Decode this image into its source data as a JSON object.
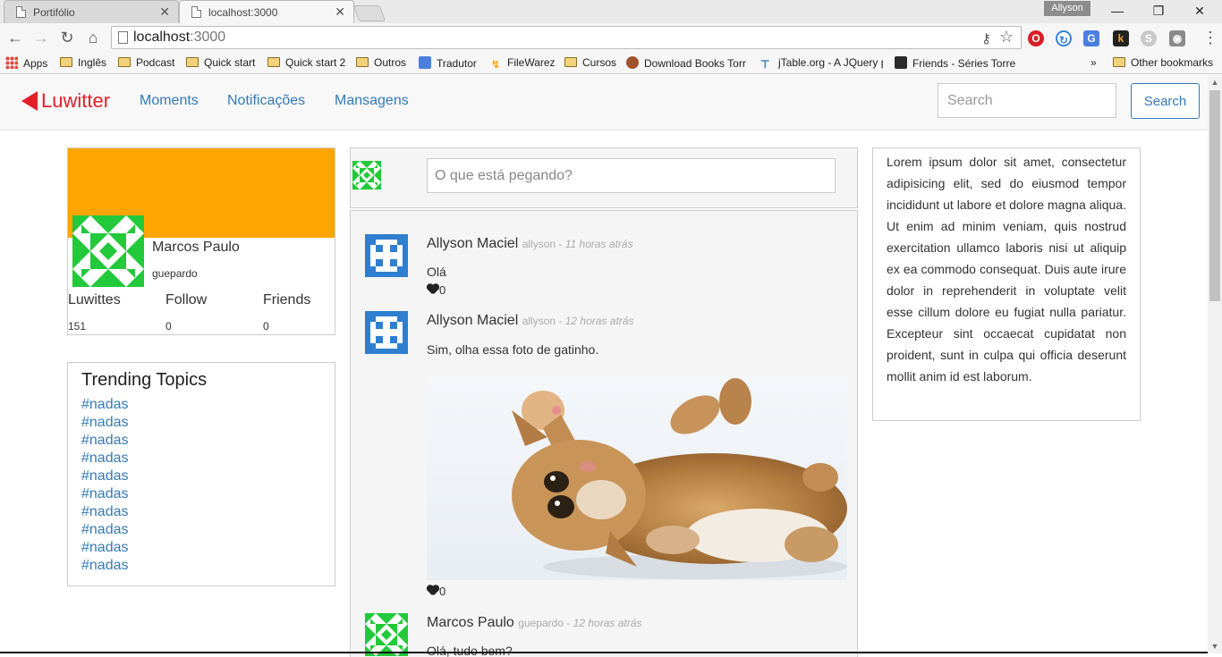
{
  "browser": {
    "tabs": [
      {
        "title": "Portifólio"
      },
      {
        "title": "localhost:3000"
      }
    ],
    "profile_name": "Allyson",
    "url_host": "localhost",
    "url_port": ":3000",
    "bookmarks": [
      {
        "label": "Apps",
        "icon": "apps-grid-icon"
      },
      {
        "label": "Inglês",
        "icon": "folder-icon"
      },
      {
        "label": "Podcast",
        "icon": "folder-icon"
      },
      {
        "label": "Quick start",
        "icon": "folder-icon"
      },
      {
        "label": "Quick start 2",
        "icon": "folder-icon"
      },
      {
        "label": "Outros",
        "icon": "folder-icon"
      },
      {
        "label": "Tradutor",
        "icon": "google-translate-icon"
      },
      {
        "label": "FileWarez",
        "icon": "lightning-icon"
      },
      {
        "label": "Cursos",
        "icon": "folder-icon"
      },
      {
        "label": "Download Books Torr",
        "icon": "shield-icon"
      },
      {
        "label": "jTable.org - A JQuery p",
        "icon": "jtable-icon"
      },
      {
        "label": "Friends - Séries Torrer",
        "icon": "site-icon"
      }
    ],
    "bookmarks_overflow": "»",
    "other_bookmarks": "Other bookmarks"
  },
  "app": {
    "brand": "Luwitter",
    "brand_color": "#e3202a",
    "nav": [
      "Moments",
      "Notificações",
      "Mansagens"
    ],
    "search": {
      "placeholder": "Search",
      "button": "Search"
    },
    "accent": "#337ab7",
    "cover_color": "#ffa500"
  },
  "profile": {
    "name": "Marcos Paulo",
    "handle": "guepardo",
    "stats": [
      {
        "label": "Luwittes",
        "value": "151"
      },
      {
        "label": "Follow",
        "value": "0"
      },
      {
        "label": "Friends",
        "value": "0"
      }
    ]
  },
  "trending": {
    "title": "Trending Topics",
    "tags": [
      "#nadas",
      "#nadas",
      "#nadas",
      "#nadas",
      "#nadas",
      "#nadas",
      "#nadas",
      "#nadas",
      "#nadas",
      "#nadas"
    ]
  },
  "compose": {
    "placeholder": "O que está pegando?"
  },
  "posts": [
    {
      "name": "Allyson Maciel",
      "handle": "allyson",
      "time": "11 horas atrás",
      "text": "Olá",
      "likes": "0"
    },
    {
      "name": "Allyson Maciel",
      "handle": "allyson",
      "time": "12 horas atrás",
      "text": "Sim, olha essa foto de gatinho.",
      "likes": "0",
      "image": "kitten-photo"
    },
    {
      "name": "Marcos Paulo",
      "handle": "guepardo",
      "time": "12 horas atrás",
      "text": "Olá, tudo bem?"
    }
  ],
  "sidebar_text": "Lorem ipsum dolor sit amet, consectetur adipisicing elit, sed do eiusmod tempor incididunt ut labore et dolore magna aliqua. Ut enim ad minim veniam, quis nostrud exercitation ullamco laboris nisi ut aliquip ex ea commodo consequat. Duis aute irure dolor in reprehenderit in voluptate velit esse cillum dolore eu fugiat nulla pariatur. Excepteur sint occaecat cupidatat non proident, sunt in culpa qui officia deserunt mollit anim id est laborum."
}
